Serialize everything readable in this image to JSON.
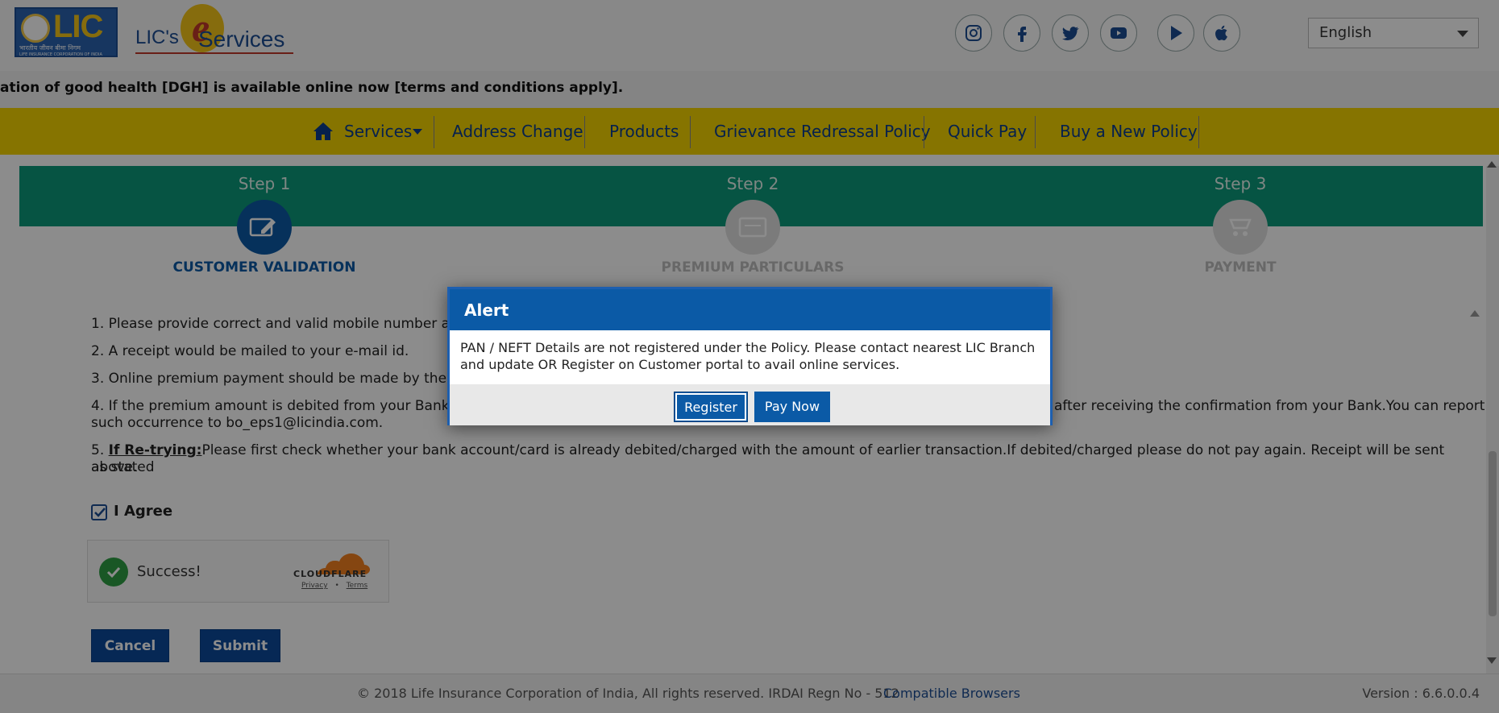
{
  "header": {
    "lic_logo_text": "LIC",
    "lic_tagline": "भारतीय जीवन बीमा निगम",
    "lic_tagline_en": "LIFE INSURANCE CORPORATION OF INDIA",
    "eservices_prefix": "LIC's",
    "eservices_e": "e",
    "eservices_suffix": "Services",
    "social": [
      "instagram-icon",
      "facebook-icon",
      "twitter-icon",
      "youtube-icon",
      "play-store-icon",
      "apple-icon"
    ],
    "language": "English"
  },
  "ticker": {
    "text": "ation of good health [DGH] is available online now [terms and conditions apply]."
  },
  "nav": {
    "services": "Services",
    "items": [
      "Address Change",
      "Products",
      "Grievance Redressal Policy",
      "Quick Pay",
      "Buy a New Policy"
    ]
  },
  "steps": [
    {
      "label": "Step 1",
      "title": "CUSTOMER VALIDATION"
    },
    {
      "label": "Step 2",
      "title": "PREMIUM PARTICULARS"
    },
    {
      "label": "Step 3",
      "title": "PAYMENT"
    }
  ],
  "instructions": {
    "i1": "1. Please provide correct and valid mobile number and",
    "i2": "2. A receipt would be mailed to your e-mail id.",
    "i3": "3. Online premium payment should be made by the po",
    "i4a": "4. If the premium amount is debited from your Bank A",
    "i4b": "after receiving the confirmation from your Bank.You can report",
    "i4c": "such occurrence to bo_eps1@licindia.com.",
    "i5_prefix": "5. ",
    "i5_bold": "If Re-trying:",
    "i5_text": "Please first check whether your bank account/card is already debited/charged with the amount of earlier transaction.If debited/charged please do not pay again. Receipt will be sent as stated",
    "i5_end": "above."
  },
  "agree": {
    "label": "I Agree",
    "checked": true
  },
  "captcha": {
    "status": "Success!",
    "brand": "CLOUDFLARE",
    "privacy": "Privacy",
    "dot": "•",
    "terms": "Terms"
  },
  "buttons": {
    "cancel": "Cancel",
    "submit": "Submit"
  },
  "footer": {
    "copyright": "© 2018 Life Insurance Corporation of India, All rights reserved. IRDAI Regn No - 512",
    "compatible": "Compatible Browsers",
    "version": "Version : 6.6.0.0.4"
  },
  "modal": {
    "title": "Alert",
    "message": "PAN / NEFT Details are not registered under the Policy. Please contact nearest LIC Branch and update OR Register on Customer portal to avail online services.",
    "register": "Register",
    "pay_now": "Pay Now"
  },
  "colors": {
    "brand_blue": "#0b5aa6",
    "nav_yellow": "#f5d400",
    "step_green": "#0b9a7a"
  }
}
